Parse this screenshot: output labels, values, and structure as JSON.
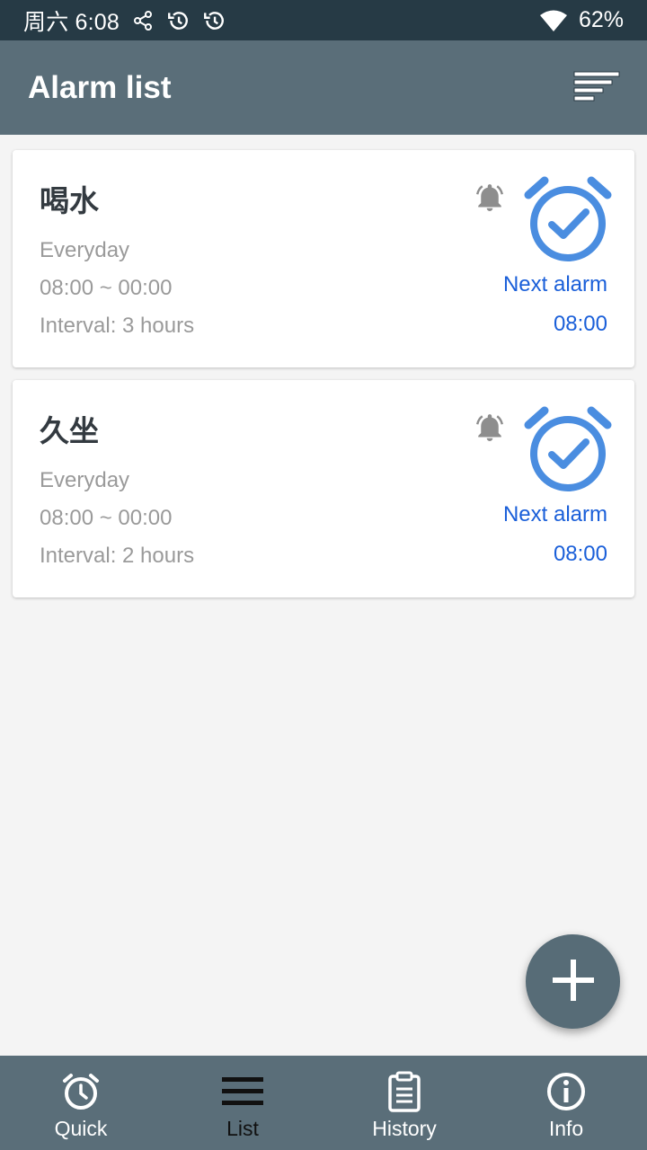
{
  "status_bar": {
    "time": "周六 6:08",
    "battery": "62%",
    "icons": [
      "share-icon",
      "history-icon",
      "history-icon",
      "wifi-icon",
      "battery-icon"
    ]
  },
  "app_bar": {
    "title": "Alarm list",
    "sort_icon": "sort-icon"
  },
  "alarms": [
    {
      "title": "喝水",
      "repeat": "Everyday",
      "range": "08:00 ~ 00:00",
      "interval": "Interval: 3 hours",
      "next_label": "Next alarm",
      "next_time": "08:00"
    },
    {
      "title": "久坐",
      "repeat": "Everyday",
      "range": "08:00 ~ 00:00",
      "interval": "Interval: 2 hours",
      "next_label": "Next alarm",
      "next_time": "08:00"
    }
  ],
  "fab": {
    "icon": "plus-icon"
  },
  "bottom_nav": {
    "items": [
      {
        "label": "Quick",
        "icon": "alarm-clock-icon",
        "active": false
      },
      {
        "label": "List",
        "icon": "list-icon",
        "active": true
      },
      {
        "label": "History",
        "icon": "clipboard-icon",
        "active": false
      },
      {
        "label": "Info",
        "icon": "info-icon",
        "active": false
      }
    ]
  },
  "colors": {
    "status_bar": "#263a45",
    "app_bar": "#5a6e79",
    "accent_blue": "#1a5fd9",
    "clock_blue": "#4a8de0",
    "background": "#f4f4f4"
  }
}
